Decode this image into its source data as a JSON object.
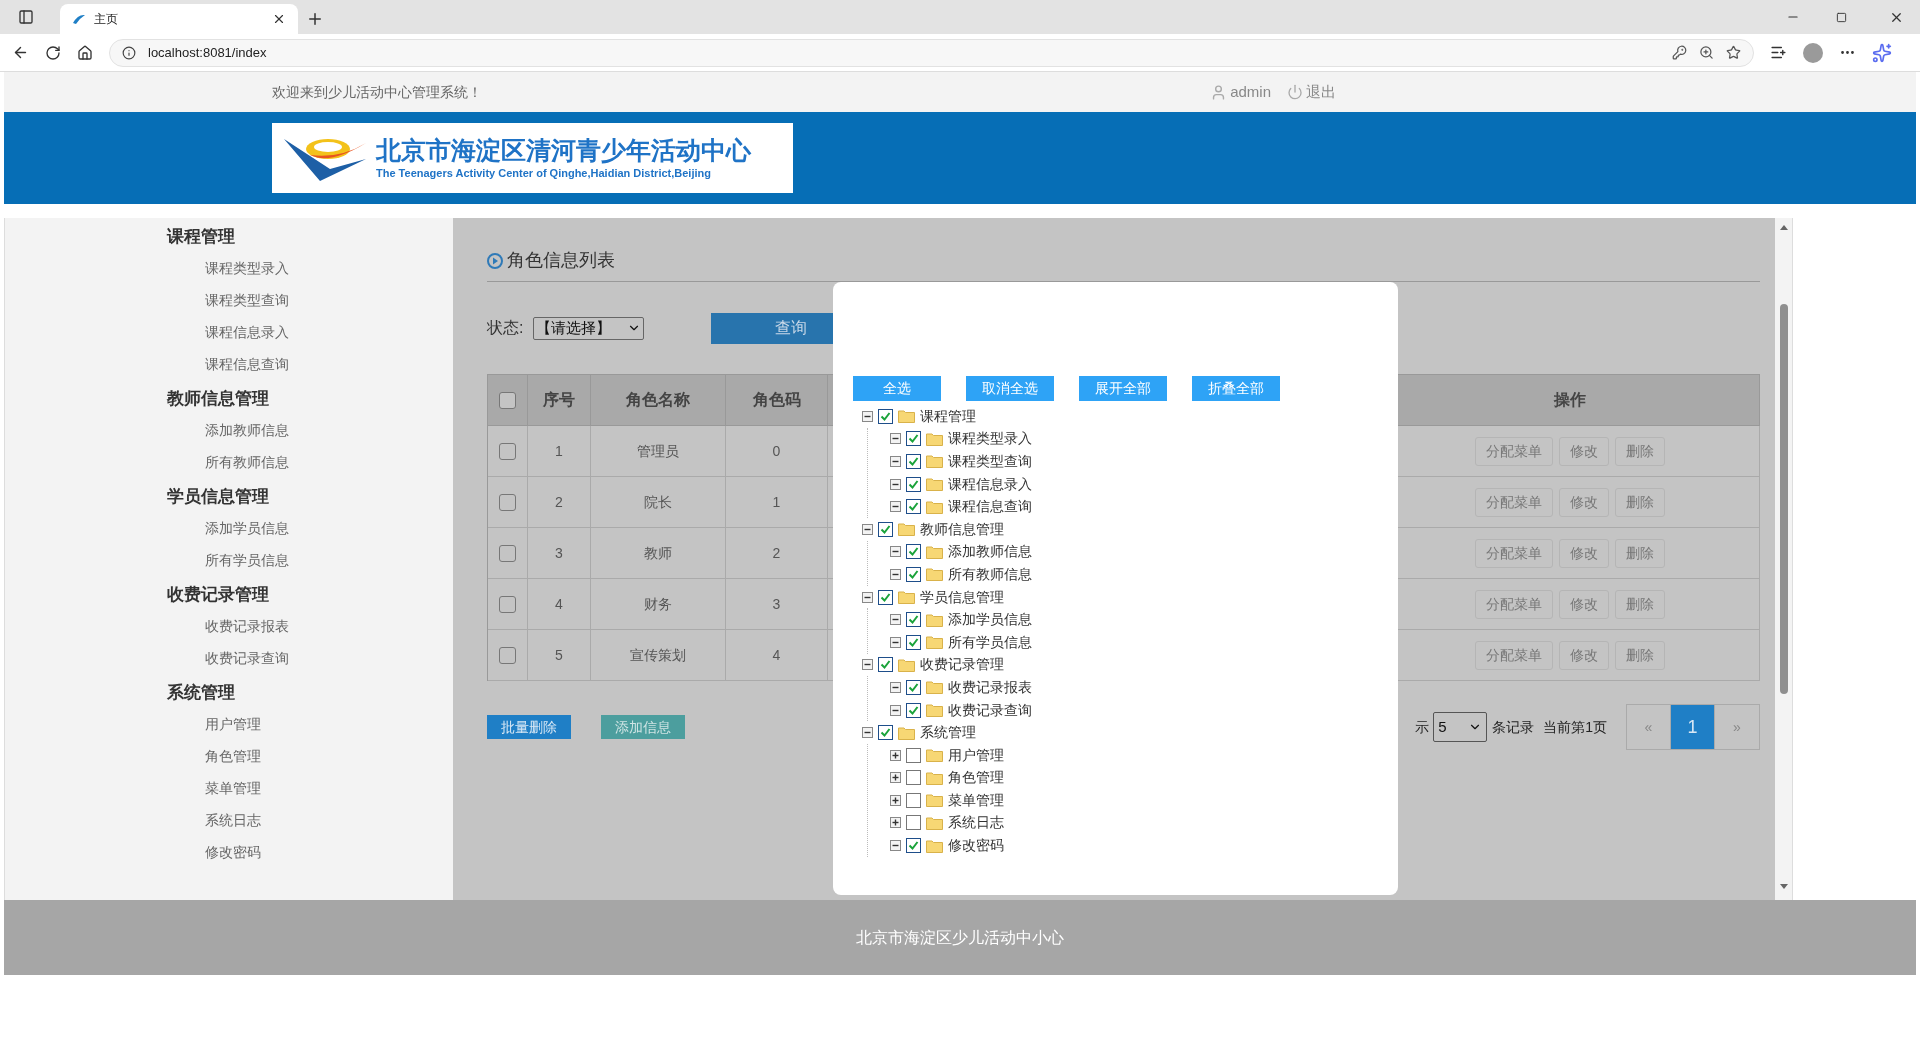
{
  "browser": {
    "tab_title": "主页",
    "url": "localhost:8081/index"
  },
  "top_bar": {
    "welcome": "欢迎来到少儿活动中心管理系统！",
    "user": "admin",
    "logout": "退出"
  },
  "logo": {
    "title": "北京市海淀区清河青少年活动中心",
    "subtitle": "The Teenagers Activity Center of Qinghe,Haidian District,Beijing"
  },
  "sidebar": [
    {
      "title": "课程管理",
      "items": [
        "课程类型录入",
        "课程类型查询",
        "课程信息录入",
        "课程信息查询"
      ]
    },
    {
      "title": "教师信息管理",
      "items": [
        "添加教师信息",
        "所有教师信息"
      ]
    },
    {
      "title": "学员信息管理",
      "items": [
        "添加学员信息",
        "所有学员信息"
      ]
    },
    {
      "title": "收费记录管理",
      "items": [
        "收费记录报表",
        "收费记录查询"
      ]
    },
    {
      "title": "系统管理",
      "items": [
        "用户管理",
        "角色管理",
        "菜单管理",
        "系统日志",
        "修改密码"
      ]
    }
  ],
  "panel": {
    "title": "角色信息列表",
    "filter_label": "状态:",
    "filter_value": "【请选择】",
    "query_button": "查询"
  },
  "table": {
    "header_checked": false,
    "columns": [
      "序号",
      "角色名称",
      "角色码",
      "操作"
    ],
    "rows": [
      {
        "checked": false,
        "cells": [
          "1",
          "管理员",
          "0"
        ],
        "actions": [
          "分配菜单",
          "修改",
          "删除"
        ]
      },
      {
        "checked": false,
        "cells": [
          "2",
          "院长",
          "1"
        ],
        "actions": [
          "分配菜单",
          "修改",
          "删除"
        ]
      },
      {
        "checked": false,
        "cells": [
          "3",
          "教师",
          "2"
        ],
        "actions": [
          "分配菜单",
          "修改",
          "删除"
        ]
      },
      {
        "checked": false,
        "cells": [
          "4",
          "财务",
          "3"
        ],
        "actions": [
          "分配菜单",
          "修改",
          "删除"
        ]
      },
      {
        "checked": false,
        "cells": [
          "5",
          "宣传策划",
          "4"
        ],
        "actions": [
          "分配菜单",
          "修改",
          "删除"
        ]
      }
    ]
  },
  "bulk_buttons": [
    {
      "label": "批量删除",
      "kind": "primary"
    },
    {
      "label": "添加信息",
      "kind": "secondary"
    }
  ],
  "pagination": {
    "show_label": "示",
    "page_size": "5",
    "records_label": "条记录",
    "current_page": "当前第1页",
    "prev": "«",
    "pages": [
      {
        "label": "1",
        "selected": true
      }
    ],
    "next": "»"
  },
  "dialog": {
    "buttons": [
      "全选",
      "取消全选",
      "展开全部",
      "折叠全部"
    ],
    "tree": [
      {
        "label": "课程管理",
        "checked": true,
        "expanded": true,
        "children": [
          {
            "label": "课程类型录入",
            "checked": true,
            "expanded": true
          },
          {
            "label": "课程类型查询",
            "checked": true,
            "expanded": true
          },
          {
            "label": "课程信息录入",
            "checked": true,
            "expanded": true
          },
          {
            "label": "课程信息查询",
            "checked": true,
            "expanded": true
          }
        ]
      },
      {
        "label": "教师信息管理",
        "checked": true,
        "expanded": true,
        "children": [
          {
            "label": "添加教师信息",
            "checked": true,
            "expanded": true
          },
          {
            "label": "所有教师信息",
            "checked": true,
            "expanded": true
          }
        ]
      },
      {
        "label": "学员信息管理",
        "checked": true,
        "expanded": true,
        "children": [
          {
            "label": "添加学员信息",
            "checked": true,
            "expanded": true
          },
          {
            "label": "所有学员信息",
            "checked": true,
            "expanded": true
          }
        ]
      },
      {
        "label": "收费记录管理",
        "checked": true,
        "expanded": true,
        "children": [
          {
            "label": "收费记录报表",
            "checked": true,
            "expanded": true
          },
          {
            "label": "收费记录查询",
            "checked": true,
            "expanded": true
          }
        ]
      },
      {
        "label": "系统管理",
        "checked": true,
        "expanded": true,
        "children": [
          {
            "label": "用户管理",
            "checked": false,
            "expanded": false
          },
          {
            "label": "角色管理",
            "checked": false,
            "expanded": false
          },
          {
            "label": "菜单管理",
            "checked": false,
            "expanded": false
          },
          {
            "label": "系统日志",
            "checked": false,
            "expanded": false
          },
          {
            "label": "修改密码",
            "checked": true,
            "expanded": true
          }
        ]
      }
    ]
  },
  "footer": "北京市海淀区少儿活动中小心"
}
